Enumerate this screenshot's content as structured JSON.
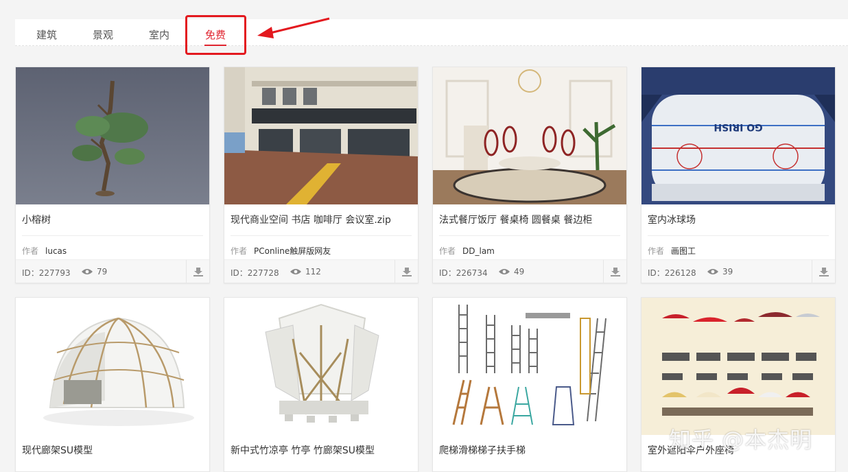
{
  "tabs": [
    {
      "label": "建筑",
      "active": false
    },
    {
      "label": "景观",
      "active": false
    },
    {
      "label": "室内",
      "active": false
    },
    {
      "label": "免费",
      "active": true
    }
  ],
  "author_label": "作者",
  "id_prefix": "ID：",
  "cards": [
    {
      "title": "小榕树",
      "author": "lucas",
      "id": "227793",
      "views": "79"
    },
    {
      "title": "现代商业空间 书店 咖啡厅 会议室.zip",
      "author": "PConline触屏版网友",
      "id": "227728",
      "views": "112"
    },
    {
      "title": "法式餐厅饭厅 餐桌椅 圆餐桌 餐边柜",
      "author": "DD_lam",
      "id": "226734",
      "views": "49"
    },
    {
      "title": "室内冰球场",
      "author": "画图工",
      "id": "226128",
      "views": "39"
    },
    {
      "title": "现代廊架SU模型"
    },
    {
      "title": "新中式竹凉亭 竹亭 竹廊架SU模型"
    },
    {
      "title": "爬梯滑梯梯子扶手梯"
    },
    {
      "title": "室外遮阳伞户外座椅"
    }
  ],
  "thumb_texts": {
    "rink_logo": "GO IRISH"
  },
  "icons": {
    "views": "eye-icon",
    "download": "download-icon"
  },
  "colors": {
    "accent": "#e0242f",
    "annotation": "#e3191f"
  },
  "watermark": "知乎 @本杰明"
}
